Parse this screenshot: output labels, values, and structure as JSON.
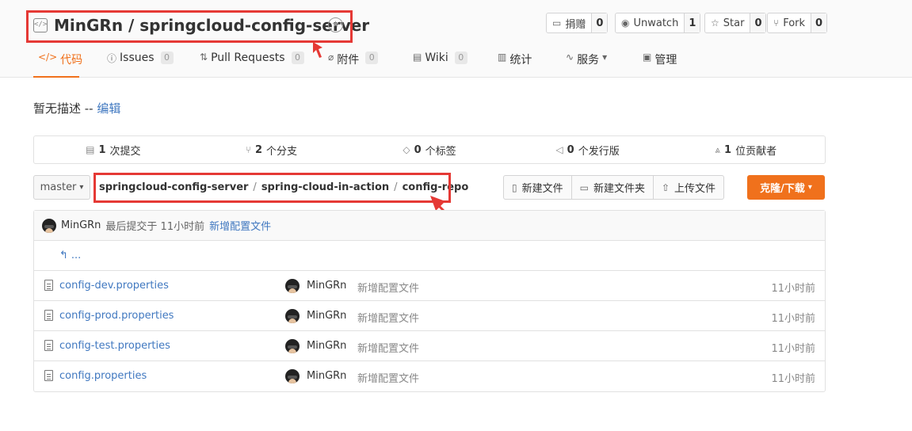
{
  "repo": {
    "owner": "MinGRn",
    "name": "springcloud-config-server",
    "title": "MinGRn / springcloud-config-server"
  },
  "header_buttons": [
    {
      "label": "捐赠",
      "count": "0",
      "icon": "donate-icon"
    },
    {
      "label": "Unwatch",
      "count": "1",
      "icon": "eye-icon"
    },
    {
      "label": "Star",
      "count": "0",
      "icon": "star-icon"
    },
    {
      "label": "Fork",
      "count": "0",
      "icon": "fork-icon"
    }
  ],
  "nav": [
    {
      "label": "代码",
      "icon": "code-icon",
      "active": true
    },
    {
      "label": "Issues",
      "count": "0",
      "icon": "issues-icon"
    },
    {
      "label": "Pull Requests",
      "count": "0",
      "icon": "pull-request-icon"
    },
    {
      "label": "附件",
      "count": "0",
      "icon": "attachment-icon"
    },
    {
      "label": "Wiki",
      "count": "0",
      "icon": "wiki-icon"
    },
    {
      "label": "统计",
      "icon": "stats-icon"
    },
    {
      "label": "服务",
      "icon": "service-icon",
      "dropdown": true
    },
    {
      "label": "管理",
      "icon": "manage-icon"
    }
  ],
  "description": {
    "text": "暂无描述 -- ",
    "edit_link": "编辑"
  },
  "stats": [
    {
      "value": "1",
      "label": "次提交",
      "icon": "commit-icon"
    },
    {
      "value": "2",
      "label": "个分支",
      "icon": "branch-icon"
    },
    {
      "value": "0",
      "label": "个标签",
      "icon": "tag-icon"
    },
    {
      "value": "0",
      "label": "个发行版",
      "icon": "release-icon"
    },
    {
      "value": "1",
      "label": "位贡献者",
      "icon": "contributor-icon"
    }
  ],
  "branch": {
    "name": "master"
  },
  "path": [
    "springcloud-config-server",
    "spring-cloud-in-action",
    "config-repo"
  ],
  "path_separator": "/",
  "actions": [
    {
      "label": "新建文件",
      "icon": "new-file-icon"
    },
    {
      "label": "新建文件夹",
      "icon": "new-folder-icon"
    },
    {
      "label": "上传文件",
      "icon": "upload-icon"
    }
  ],
  "clone_button": {
    "label": "克隆/下载"
  },
  "last_commit": {
    "user": "MinGRn",
    "meta": "最后提交于 11小时前",
    "message": "新增配置文件"
  },
  "up_dir": {
    "label": "..."
  },
  "files": [
    {
      "name": "config-dev.properties",
      "user": "MinGRn",
      "message": "新增配置文件",
      "time": "11小时前"
    },
    {
      "name": "config-prod.properties",
      "user": "MinGRn",
      "message": "新增配置文件",
      "time": "11小时前"
    },
    {
      "name": "config-test.properties",
      "user": "MinGRn",
      "message": "新增配置文件",
      "time": "11小时前"
    },
    {
      "name": "config.properties",
      "user": "MinGRn",
      "message": "新增配置文件",
      "time": "11小时前"
    }
  ],
  "colors": {
    "accent": "#f0711c",
    "link": "#4078c0",
    "annotation": "#e53935"
  }
}
